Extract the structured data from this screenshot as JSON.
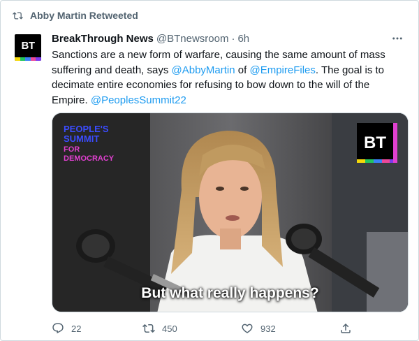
{
  "retweet_header": {
    "label": "Abby Martin Retweeted",
    "icon": "retweet-icon"
  },
  "tweet": {
    "author_name": "BreakThrough News",
    "author_handle": "@BTnewsroom",
    "separator": "·",
    "timestamp": "6h",
    "avatar_text": "BT",
    "text_parts": {
      "p1": "Sanctions are a new form of warfare, causing the same amount of mass suffering and death, says ",
      "mention1": "@AbbyMartin",
      "p2": " of ",
      "mention2": "@EmpireFiles",
      "p3": ". The goal is to decimate entire economies for refusing to bow down to the will of the Empire. ",
      "mention3": "@PeoplesSummit22"
    },
    "media": {
      "overlay_title_line1": "PEOPLE'S",
      "overlay_title_line2": "SUMMIT",
      "overlay_title_line3": "FOR",
      "overlay_title_line4": "DEMOCRACY",
      "watermark": "BT",
      "caption": "But what really happens?"
    },
    "actions": {
      "replies": "22",
      "retweets": "450",
      "likes": "932"
    }
  },
  "colors": {
    "link": "#1d9bf0",
    "muted": "#536471",
    "text": "#0f1419",
    "border": "#cfd9de"
  }
}
